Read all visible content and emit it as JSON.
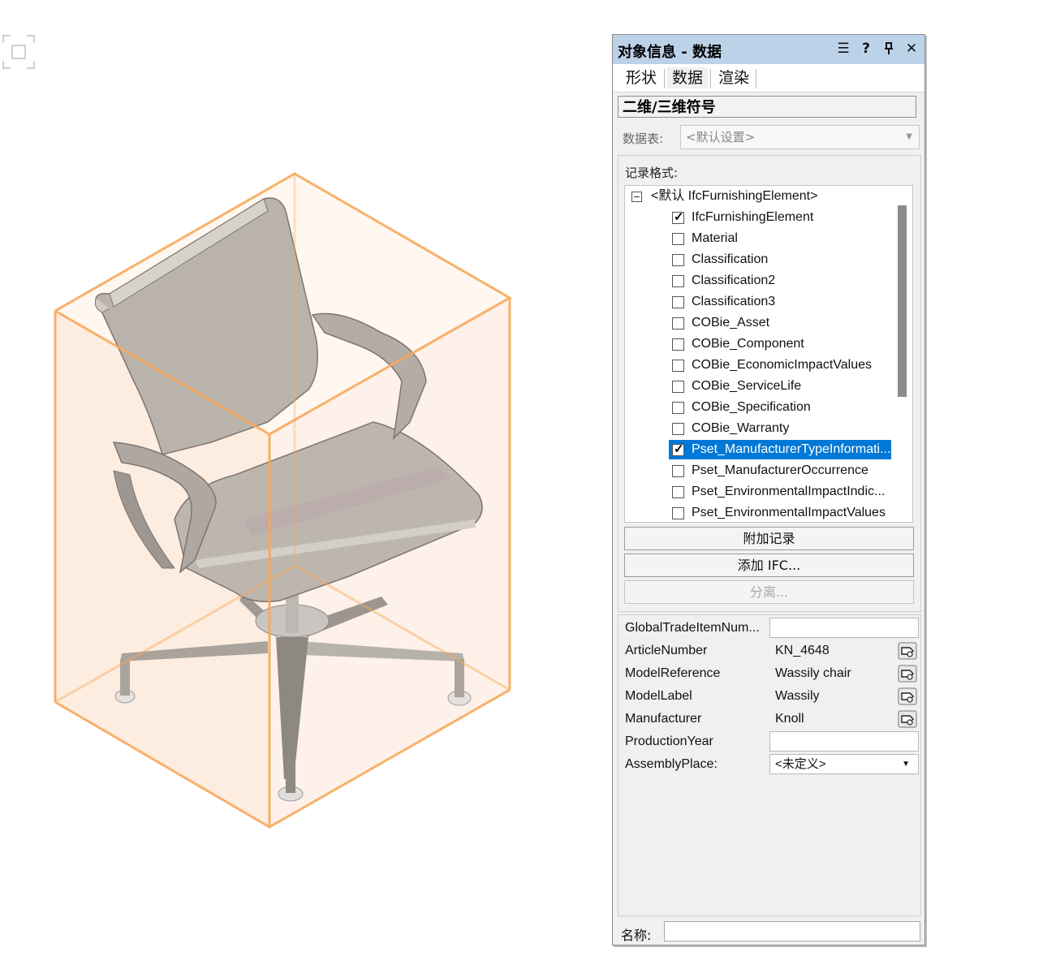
{
  "palette": {
    "title": "对象信息 - 数据",
    "title_buttons": [
      "☰",
      "?",
      "⊥",
      "✕"
    ],
    "tabs": [
      "形状",
      "数据",
      "渲染"
    ],
    "active_tab": "数据",
    "section_title": "二维/三维符号",
    "datasheet_label": "数据表:",
    "datasheet_value": "<默认设置>",
    "record_format_label": "记录格式:",
    "tree_root": "<默认 IfcFurnishingElement>",
    "records": [
      {
        "label": "IfcFurnishingElement",
        "checked": true
      },
      {
        "label": "Material",
        "checked": false
      },
      {
        "label": "Classification",
        "checked": false
      },
      {
        "label": "Classification2",
        "checked": false
      },
      {
        "label": "Classification3",
        "checked": false
      },
      {
        "label": "COBie_Asset",
        "checked": false
      },
      {
        "label": "COBie_Component",
        "checked": false
      },
      {
        "label": "COBie_EconomicImpactValues",
        "checked": false
      },
      {
        "label": "COBie_ServiceLife",
        "checked": false
      },
      {
        "label": "COBie_Specification",
        "checked": false
      },
      {
        "label": "COBie_Warranty",
        "checked": false
      },
      {
        "label": "Pset_ManufacturerTypeInformati...",
        "checked": true,
        "selected": true
      },
      {
        "label": "Pset_ManufacturerOccurrence",
        "checked": false
      },
      {
        "label": "Pset_EnvironmentalImpactIndic...",
        "checked": false
      },
      {
        "label": "Pset_EnvironmentalImpactValues",
        "checked": false
      }
    ],
    "buttons": {
      "attach_record": "附加记录",
      "add_ifc": "添加 IFC...",
      "detach": "分离..."
    },
    "properties": [
      {
        "label": "GlobalTradeItemNum...",
        "value": "",
        "kind": "input"
      },
      {
        "label": "ArticleNumber",
        "value": "KN_4648",
        "kind": "linked"
      },
      {
        "label": "ModelReference",
        "value": "Wassily chair",
        "kind": "linked"
      },
      {
        "label": "ModelLabel",
        "value": "Wassily",
        "kind": "linked"
      },
      {
        "label": "Manufacturer",
        "value": "Knoll",
        "kind": "linked"
      },
      {
        "label": "ProductionYear",
        "value": "",
        "kind": "input"
      },
      {
        "label": "AssemblyPlace:",
        "value": "<未定义>",
        "kind": "select"
      }
    ],
    "name_label": "名称:",
    "name_value": ""
  },
  "colors": {
    "bbox_edge": "#f7a85a",
    "bbox_fill": "#fde9da",
    "titlebar": "#bcd2e9",
    "selection": "#0078d7"
  }
}
